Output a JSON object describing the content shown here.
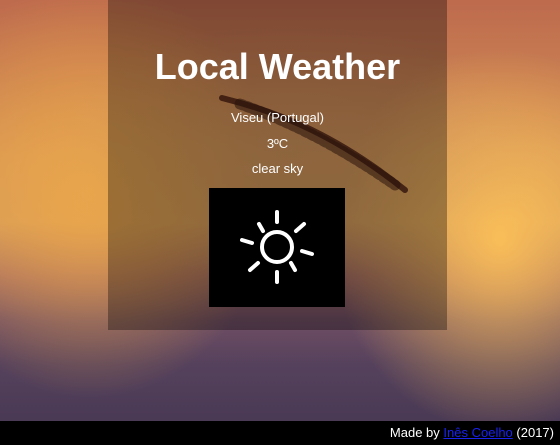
{
  "app": {
    "title": "Local Weather"
  },
  "weather": {
    "location": "Viseu (Portugal)",
    "temperature": "3ºC",
    "description": "clear sky",
    "icon": "sun-icon"
  },
  "footer": {
    "prefix": "Made by ",
    "author_link": "Inês Coelho",
    "suffix": " (2017)"
  },
  "colors": {
    "panel_overlay": "rgba(0,0,0,0.32)",
    "icon_background": "#000000",
    "link": "#1a22ee",
    "text": "#ffffff"
  }
}
